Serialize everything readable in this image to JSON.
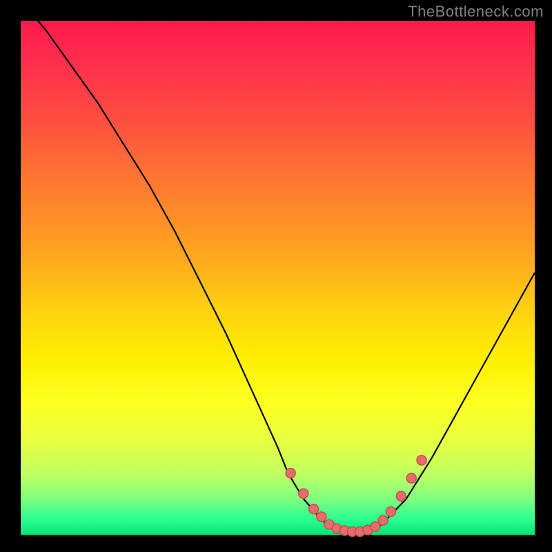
{
  "watermark": "TheBottleneck.com",
  "chart_data": {
    "type": "line",
    "title": "",
    "xlabel": "",
    "ylabel": "",
    "xlim": [
      0,
      100
    ],
    "ylim": [
      0,
      100
    ],
    "curve": {
      "x": [
        0,
        5,
        10,
        15,
        20,
        25,
        30,
        35,
        40,
        45,
        50,
        52,
        55,
        58,
        60,
        62,
        65,
        68,
        70,
        75,
        80,
        85,
        90,
        95,
        100
      ],
      "y": [
        104,
        98,
        91,
        84,
        76,
        68,
        59,
        49,
        39,
        28,
        17,
        12,
        7,
        3.5,
        1.5,
        0.7,
        0.5,
        0.8,
        1.8,
        7,
        15,
        24,
        33,
        42,
        51
      ]
    },
    "markers": {
      "x": [
        52.5,
        55.0,
        57.0,
        58.5,
        60.0,
        61.5,
        63.0,
        64.5,
        66.0,
        67.5,
        69.0,
        70.5,
        72.0,
        74.0,
        76.0,
        78.0
      ],
      "y": [
        12.0,
        8.0,
        5.0,
        3.5,
        2.0,
        1.2,
        0.8,
        0.6,
        0.6,
        0.9,
        1.6,
        2.8,
        4.5,
        7.5,
        11.0,
        14.5
      ]
    },
    "background_gradient": {
      "top": "#ff1a4d",
      "mid": "#fff000",
      "bottom": "#00e676"
    }
  }
}
